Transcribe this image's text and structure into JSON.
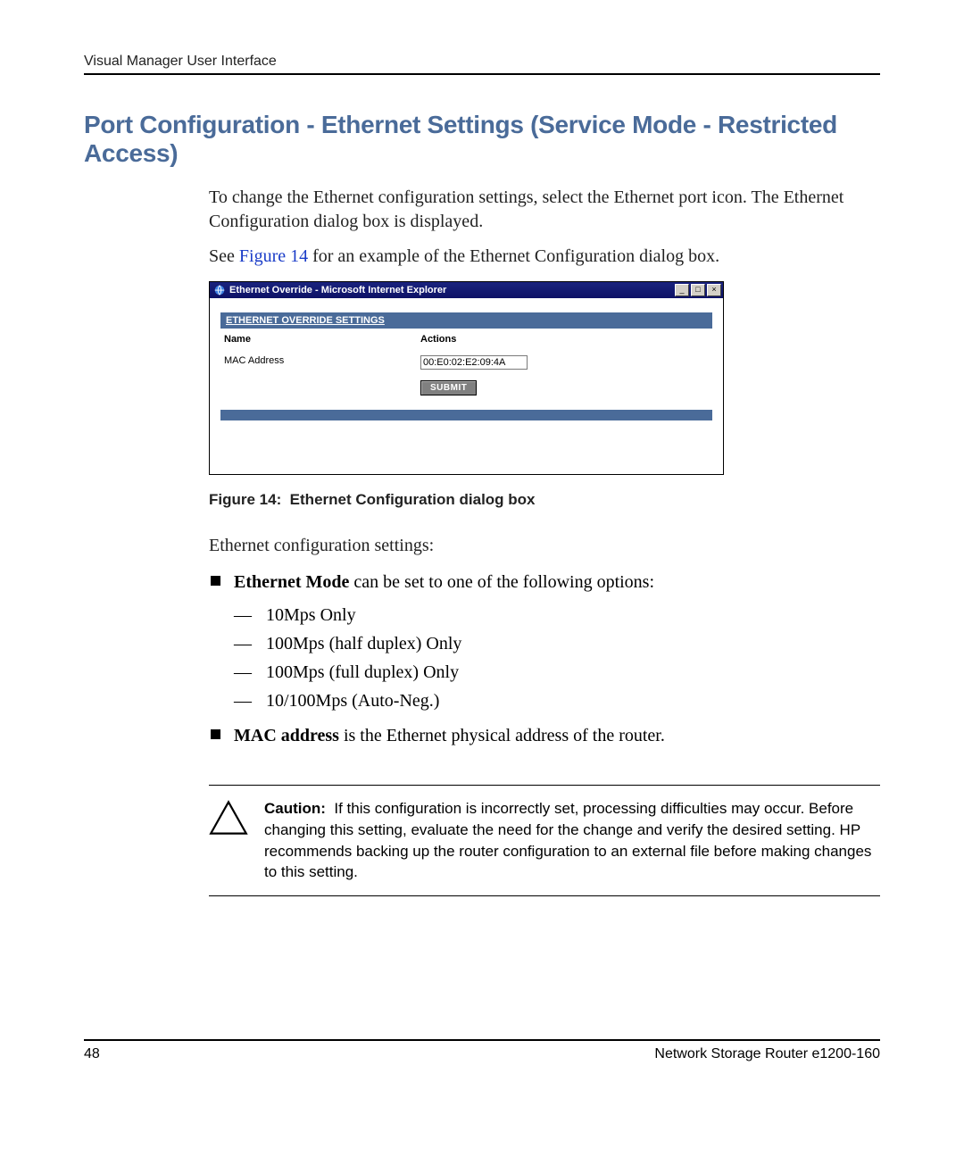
{
  "runningHead": "Visual Manager User Interface",
  "title": "Port Configuration - Ethernet Settings (Service Mode - Restricted Access)",
  "intro1": "To change the Ethernet configuration settings, select the Ethernet port icon. The Ethernet Configuration dialog box is displayed.",
  "intro2_pre": "See ",
  "intro2_ref": "Figure 14",
  "intro2_post": " for an example of the Ethernet Configuration dialog box.",
  "dialog": {
    "windowTitle": "Ethernet Override - Microsoft Internet Explorer",
    "minimize": "_",
    "maximize": "□",
    "close": "×",
    "header": "ETHERNET OVERRIDE SETTINGS",
    "nameCol": "Name",
    "actionsCol": "Actions",
    "rowLabel": "MAC Address",
    "macValue": "00:E0:02:E2:09:4A",
    "submit": "SUBMIT"
  },
  "figureCaption": "Figure 14:  Ethernet Configuration dialog box",
  "lead": "Ethernet configuration settings:",
  "item1_bold": "Ethernet Mode",
  "item1_rest": " can be set to one of the following options:",
  "modes": {
    "m1": "10Mps Only",
    "m2": "100Mps (half duplex) Only",
    "m3": "100Mps (full duplex) Only",
    "m4": "10/100Mps (Auto-Neg.)"
  },
  "item2_bold": "MAC address",
  "item2_rest": " is the Ethernet physical address of the router.",
  "cautionLabel": "Caution:  ",
  "cautionBody": "If this configuration is incorrectly set, processing difficulties may occur. Before changing this setting, evaluate the need for the change and verify the desired setting. HP recommends backing up the router configuration to an external file before making changes to this setting.",
  "pageNumber": "48",
  "footerRight": "Network Storage Router e1200-160"
}
